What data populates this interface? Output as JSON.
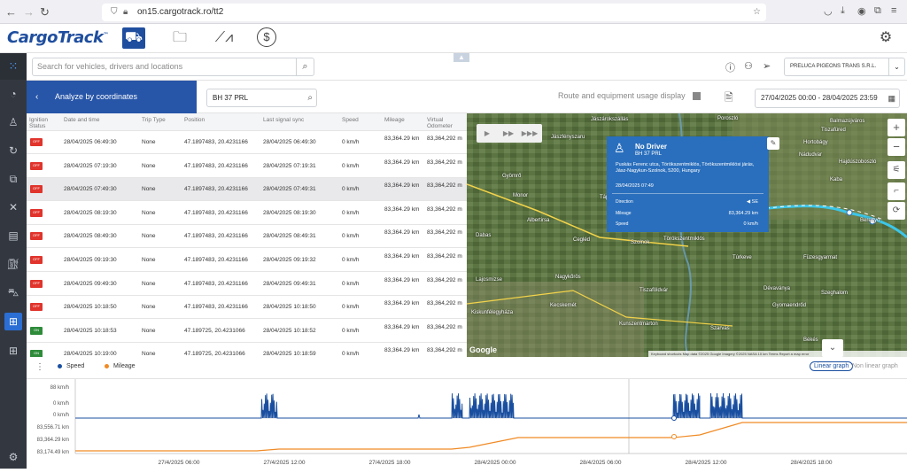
{
  "browser": {
    "url": "on15.cargotrack.ro/tt2"
  },
  "header": {
    "logo": "CargoTrack",
    "logo_tm": "™"
  },
  "search": {
    "placeholder": "Search for vehicles, drivers and locations"
  },
  "company": {
    "name": "PRELUCA PIGEONS TRANS S.R.L."
  },
  "toolbar": {
    "analyze_label": "Analyze by coordinates",
    "vehicle": "BH 37 PRL",
    "route_label": "Route and equipment usage display",
    "date_range": "27/04/2025 00:00 - 28/04/2025 23:59"
  },
  "table": {
    "columns": [
      "Ignition Status",
      "Date and time",
      "Trip Type",
      "Position",
      "Last signal sync",
      "Speed",
      "Mileage",
      "Virtual Odometer"
    ],
    "rows": [
      {
        "status": "OFF",
        "dt": "28/04/2025 06:49:30",
        "trip": "None",
        "pos": "47.1897483, 20.4231166",
        "sync": "28/04/2025 06:49:30",
        "speed": "0 km/h",
        "mileage": "83,364.29 km",
        "odo": "83,364,292 m"
      },
      {
        "status": "OFF",
        "dt": "28/04/2025 07:19:30",
        "trip": "None",
        "pos": "47.1897483, 20.4231166",
        "sync": "28/04/2025 07:19:31",
        "speed": "0 km/h",
        "mileage": "83,364.29 km",
        "odo": "83,364,292 m"
      },
      {
        "status": "OFF",
        "dt": "28/04/2025 07:49:30",
        "trip": "None",
        "pos": "47.1897483, 20.4231166",
        "sync": "28/04/2025 07:49:31",
        "speed": "0 km/h",
        "mileage": "83,364.29 km",
        "odo": "83,364,292 m"
      },
      {
        "status": "OFF",
        "dt": "28/04/2025 08:19:30",
        "trip": "None",
        "pos": "47.1897483, 20.4231166",
        "sync": "28/04/2025 08:19:30",
        "speed": "0 km/h",
        "mileage": "83,364.29 km",
        "odo": "83,364,292 m"
      },
      {
        "status": "OFF",
        "dt": "28/04/2025 08:49:30",
        "trip": "None",
        "pos": "47.1897483, 20.4231166",
        "sync": "28/04/2025 08:49:31",
        "speed": "0 km/h",
        "mileage": "83,364.29 km",
        "odo": "83,364,292 m"
      },
      {
        "status": "OFF",
        "dt": "28/04/2025 09:19:30",
        "trip": "None",
        "pos": "47.1897483, 20.4231166",
        "sync": "28/04/2025 09:19:32",
        "speed": "0 km/h",
        "mileage": "83,364.29 km",
        "odo": "83,364,292 m"
      },
      {
        "status": "OFF",
        "dt": "28/04/2025 09:49:30",
        "trip": "None",
        "pos": "47.1897483, 20.4231166",
        "sync": "28/04/2025 09:49:31",
        "speed": "0 km/h",
        "mileage": "83,364.29 km",
        "odo": "83,364,292 m"
      },
      {
        "status": "OFF",
        "dt": "28/04/2025 10:18:50",
        "trip": "None",
        "pos": "47.1897483, 20.4231166",
        "sync": "28/04/2025 10:18:50",
        "speed": "0 km/h",
        "mileage": "83,364.29 km",
        "odo": "83,364,292 m"
      },
      {
        "status": "ON",
        "dt": "28/04/2025 10:18:53",
        "trip": "None",
        "pos": "47.189725, 20.4231066",
        "sync": "28/04/2025 10:18:52",
        "speed": "0 km/h",
        "mileage": "83,364.29 km",
        "odo": "83,364,292 m"
      },
      {
        "status": "ON",
        "dt": "28/04/2025 10:19:00",
        "trip": "None",
        "pos": "47.189725, 20.4231066",
        "sync": "28/04/2025 10:18:59",
        "speed": "0 km/h",
        "mileage": "83,364.29 km",
        "odo": "83,364,292 m"
      }
    ]
  },
  "popup": {
    "title": "No Driver",
    "vehicle": "BH 37 PRL",
    "address": "Puskás Ferenc utca, Törökszentmiklós, Törökszentmiklósi járás, Jász-Nagykun-Szolnok, 5200, Hungary",
    "datetime": "28/04/2025 07:49",
    "direction_label": "Direction",
    "direction_value": "SE",
    "mileage_label": "Mileage",
    "mileage_value": "83,364.29 km",
    "speed_label": "Speed",
    "speed_value": "0 km/h"
  },
  "map": {
    "attribution": "Keyboard shortcuts   Map data ©2025 Google Imagery ©2025 NASA   10 km   Terms   Report a map error",
    "google": "Google",
    "places": [
      "Jászárokszállás",
      "Poroszló",
      "Jászfényszaru",
      "Tiszafüred",
      "Balmazújváros",
      "Gyömrő",
      "Monor",
      "Hortobágy",
      "Jászberény",
      "Hajdúszoboszló",
      "Tápioszentmárton",
      "Nádudvar",
      "Albertirsa",
      "Kaba",
      "Cegléd",
      "Szolnok",
      "Törökszentmiklós",
      "Berettyó",
      "Dabas",
      "Túrkeve",
      "Füzesgyarmat",
      "Lajosmizse",
      "Nagykőrös",
      "Tiszaföldvár",
      "Dévaványa",
      "Szeghalom",
      "Kecskemét",
      "Gyomaendrőd",
      "Kiskunfélegyháza",
      "Kunszentmárton",
      "Szarvas",
      "Békés"
    ]
  },
  "chart": {
    "legend_speed": "Speed",
    "legend_mileage": "Mileage",
    "mode_linear": "Linear graph",
    "mode_nonlinear": "Non linear graph",
    "speed_ticks": [
      "88 km/h",
      "0 km/h",
      "0 km/h"
    ],
    "mileage_ticks": [
      "83,556.71 km",
      "83,364.29 km",
      "83,174.49 km"
    ],
    "x_ticks": [
      "27/4/2025 06:00",
      "27/4/2025 12:00",
      "27/4/2025 18:00",
      "28/4/2025 00:00",
      "28/4/2025 06:00",
      "28/4/2025 12:00",
      "28/4/2025 18:00"
    ],
    "colors": {
      "speed": "#1a4fa0",
      "mileage": "#f08a24"
    }
  }
}
